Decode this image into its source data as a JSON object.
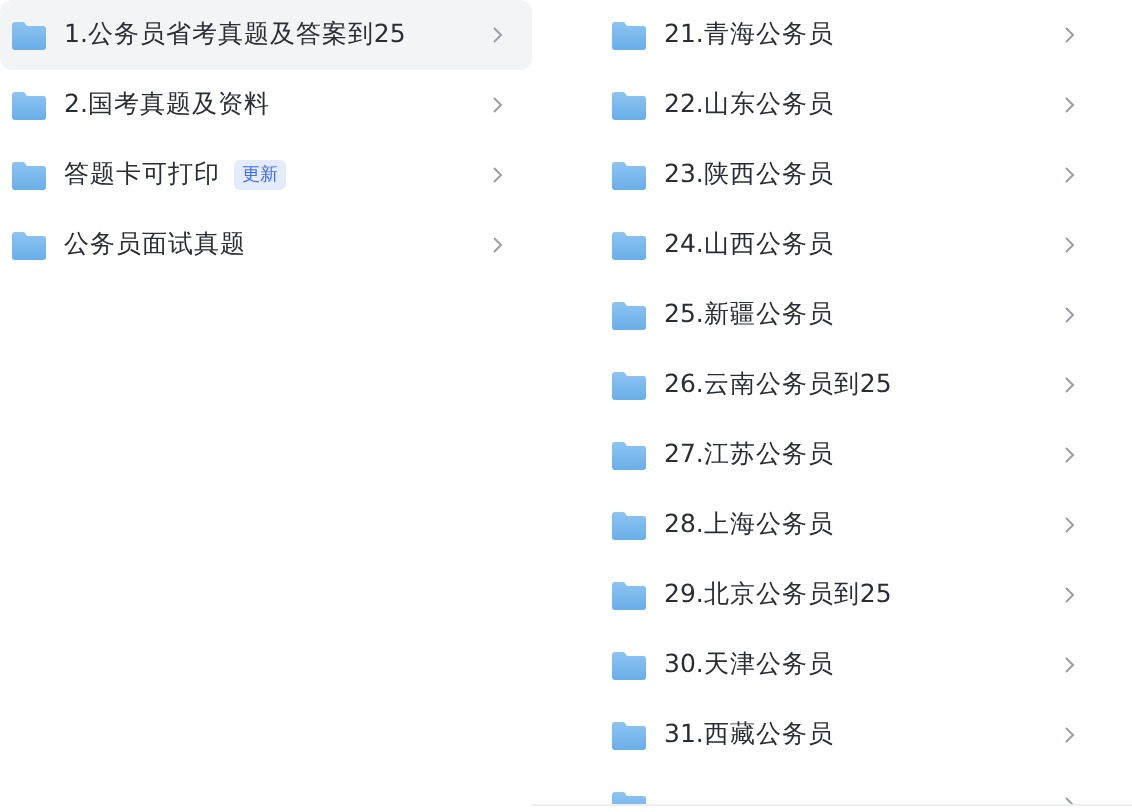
{
  "left_list": [
    {
      "label": "1.公务员省考真题及答案到25",
      "selected": true
    },
    {
      "label": "2.国考真题及资料",
      "selected": false
    },
    {
      "label": "答题卡可打印",
      "badge": "更新",
      "selected": false
    },
    {
      "label": "公务员面试真题",
      "selected": false
    }
  ],
  "right_list": [
    {
      "label": "21.青海公务员",
      "selected": false
    },
    {
      "label": "22.山东公务员",
      "selected": false
    },
    {
      "label": "23.陕西公务员",
      "selected": false
    },
    {
      "label": "24.山西公务员",
      "selected": false
    },
    {
      "label": "25.新疆公务员",
      "selected": false
    },
    {
      "label": "26.云南公务员到25",
      "selected": false
    },
    {
      "label": "27.江苏公务员",
      "selected": false
    },
    {
      "label": "28.上海公务员",
      "selected": false
    },
    {
      "label": "29.北京公务员到25",
      "selected": false
    },
    {
      "label": "30.天津公务员",
      "selected": false
    },
    {
      "label": "31.西藏公务员",
      "selected": false
    },
    {
      "selected": false
    }
  ]
}
